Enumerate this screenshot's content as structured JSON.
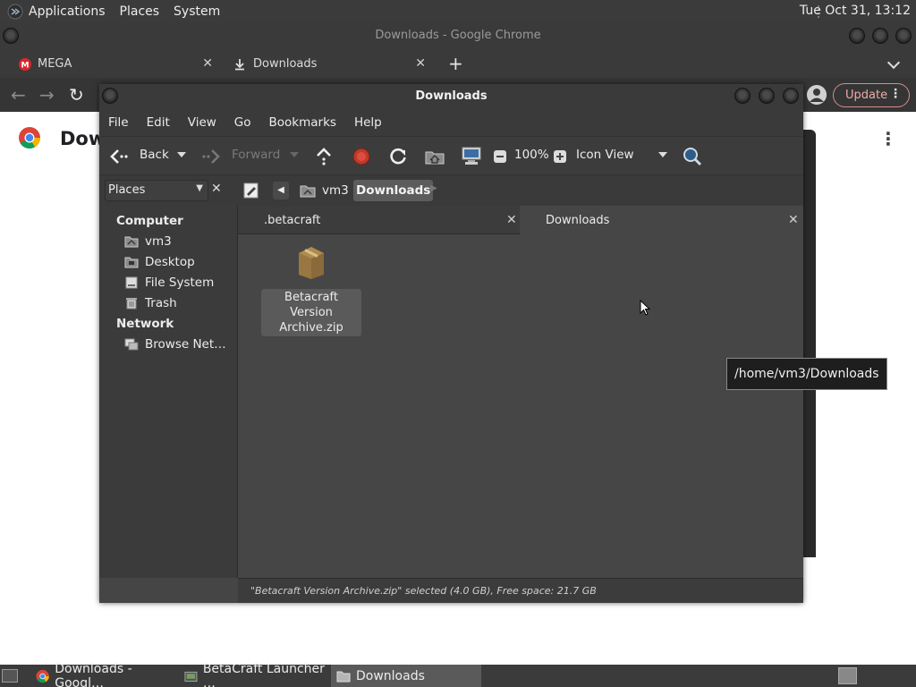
{
  "top_panel": {
    "menus": [
      "Applications",
      "Places",
      "System"
    ],
    "clock": "Tue Oct 31, 13:12"
  },
  "chrome": {
    "window_title": "Downloads - Google Chrome",
    "tabs": [
      {
        "label": "MEGA",
        "icon": "mega-icon"
      },
      {
        "label": "Downloads",
        "icon": "download-icon"
      }
    ],
    "new_tab": "+",
    "update_label": "Update",
    "page_title_partial": "Dow"
  },
  "caja": {
    "window_title": "Downloads",
    "menus": [
      "File",
      "Edit",
      "View",
      "Go",
      "Bookmarks",
      "Help"
    ],
    "toolbar": {
      "back": "Back",
      "forward": "Forward",
      "zoom": "100%",
      "view_mode": "Icon View"
    },
    "places_combo": "Places",
    "breadcrumb": [
      "vm3",
      "Downloads"
    ],
    "sidebar": {
      "computer_heading": "Computer",
      "computer_items": [
        "vm3",
        "Desktop",
        "File System",
        "Trash"
      ],
      "network_heading": "Network",
      "network_items": [
        "Browse Net…"
      ]
    },
    "tabs": [
      {
        "label": ".betacraft",
        "active": false
      },
      {
        "label": "Downloads",
        "active": true
      }
    ],
    "files": [
      {
        "name_line1": "Betacraft Version",
        "name_line2": "Archive.zip",
        "icon": "zip-archive-icon",
        "selected": true
      }
    ],
    "tooltip": "/home/vm3/Downloads",
    "status": "\"Betacraft Version Archive.zip\" selected (4.0 GB), Free space: 21.7 GB"
  },
  "taskbar": {
    "tasks": [
      {
        "label": "Downloads - Googl…",
        "icon": "chrome-icon",
        "active": false
      },
      {
        "label": "BetaCraft Launcher …",
        "icon": "java-app-icon",
        "active": false
      },
      {
        "label": "Downloads",
        "icon": "folder-icon",
        "active": true
      }
    ]
  },
  "colors": {
    "panel_bg": "#3b3b3b",
    "window_bg": "#454545",
    "accent_update": "#d48d8d"
  }
}
